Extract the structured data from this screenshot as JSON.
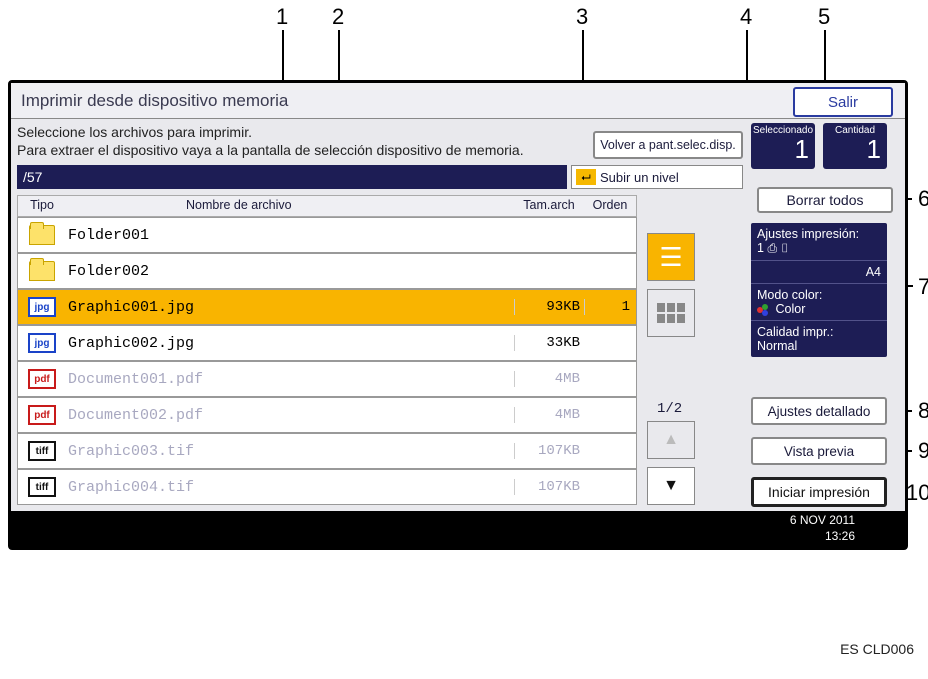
{
  "header": {
    "title": "Imprimir desde dispositivo memoria",
    "exit_label": "Salir"
  },
  "instructions": {
    "line1": "Seleccione los archivos para imprimir.",
    "line2": "Para extraer el dispositivo vaya a la pantalla de selección dispositivo de memoria."
  },
  "buttons": {
    "back_disp": "Volver a pant.selec.disp.",
    "up_level": "Subir un nivel",
    "clear_all": "Borrar todos",
    "detailed": "Ajustes detallado",
    "preview": "Vista previa",
    "start": "Iniciar impresión"
  },
  "counters": {
    "selected_label": "Seleccionado",
    "selected_value": "1",
    "quantity_label": "Cantidad",
    "quantity_value": "1"
  },
  "path": "/57",
  "columns": {
    "type": "Tipo",
    "name": "Nombre de archivo",
    "size": "Tam.arch",
    "order": "Orden"
  },
  "files": [
    {
      "icon": "folder",
      "name": "Folder001",
      "size": "",
      "order": "",
      "selected": false,
      "disabled": false
    },
    {
      "icon": "folder",
      "name": "Folder002",
      "size": "",
      "order": "",
      "selected": false,
      "disabled": false
    },
    {
      "icon": "jpg",
      "name": "Graphic001.jpg",
      "size": "93KB",
      "order": "1",
      "selected": true,
      "disabled": false
    },
    {
      "icon": "jpg",
      "name": "Graphic002.jpg",
      "size": "33KB",
      "order": "",
      "selected": false,
      "disabled": false
    },
    {
      "icon": "pdf",
      "name": "Document001.pdf",
      "size": "4MB",
      "order": "",
      "selected": false,
      "disabled": true
    },
    {
      "icon": "pdf",
      "name": "Document002.pdf",
      "size": "4MB",
      "order": "",
      "selected": false,
      "disabled": true
    },
    {
      "icon": "tiff",
      "name": "Graphic003.tif",
      "size": "107KB",
      "order": "",
      "selected": false,
      "disabled": true
    },
    {
      "icon": "tiff",
      "name": "Graphic004.tif",
      "size": "107KB",
      "order": "",
      "selected": false,
      "disabled": true
    }
  ],
  "info": {
    "print_settings_label": "Ajustes impresión:",
    "print_settings_value": "1",
    "paper": "A4",
    "color_label": "Modo color:",
    "color_value": "Color",
    "quality_label": "Calidad impr.:",
    "quality_value": "Normal"
  },
  "paging": {
    "indicator": "1/2"
  },
  "clock": {
    "date": "6 NOV  2011",
    "time": "13:26"
  },
  "doc_code": "ES CLD006",
  "callouts": {
    "1": "1",
    "2": "2",
    "3": "3",
    "4": "4",
    "5": "5",
    "6": "6",
    "7": "7",
    "8": "8",
    "9": "9",
    "10": "10"
  }
}
